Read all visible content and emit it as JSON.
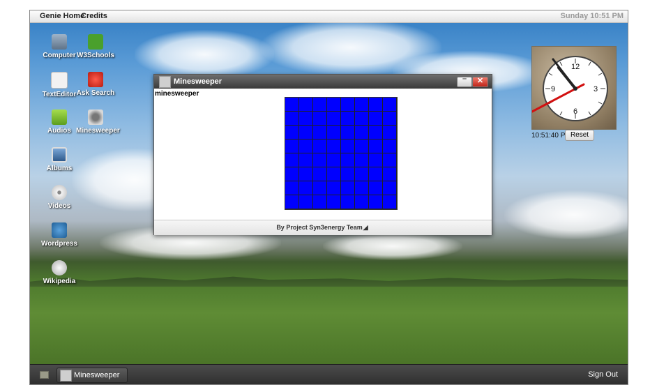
{
  "topbar": {
    "menu_home": "Genie Home",
    "menu_credits": "Credits",
    "datetime": "Sunday 10:51 PM"
  },
  "desktop_icons": [
    {
      "label": "Computer",
      "icon": "computer-icon",
      "color": "#6b7d8f"
    },
    {
      "label": "W3Schools",
      "icon": "w3schools-icon",
      "color": "#4aa02c"
    },
    {
      "label": "TextEditor",
      "icon": "text-editor-icon",
      "color": "#e8e8e8"
    },
    {
      "label": "Ask Search",
      "icon": "ask-search-icon",
      "color": "#d9261c"
    },
    {
      "label": "Audios",
      "icon": "audios-icon",
      "color": "#7cc230"
    },
    {
      "label": "Minesweeper",
      "icon": "minesweeper-icon",
      "color": "#cfcfcf"
    },
    {
      "label": "Albums",
      "icon": "albums-icon",
      "color": "#3d6fa8"
    },
    {
      "label": "Videos",
      "icon": "videos-icon",
      "color": "#dcdcdc"
    },
    {
      "label": "Wordpress",
      "icon": "wordpress-icon",
      "color": "#2f77b5"
    },
    {
      "label": "Wikipedia",
      "icon": "wikipedia-icon",
      "color": "#e6e6e6"
    }
  ],
  "window": {
    "title": "Minesweeper",
    "heading": "minesweeper",
    "footer": "By Project Syn3energy Team",
    "grid_rows": 8,
    "grid_cols": 8,
    "cell_color": "#0000ff",
    "minimize_glyph": "–",
    "close_glyph": "✕"
  },
  "clock": {
    "time_text": "10:51:40 PM",
    "reset_label": "Reset",
    "face_numbers": [
      "12",
      "3",
      "6",
      "9"
    ]
  },
  "taskbar": {
    "task_label": "Minesweeper",
    "signout_label": "Sign Out"
  }
}
